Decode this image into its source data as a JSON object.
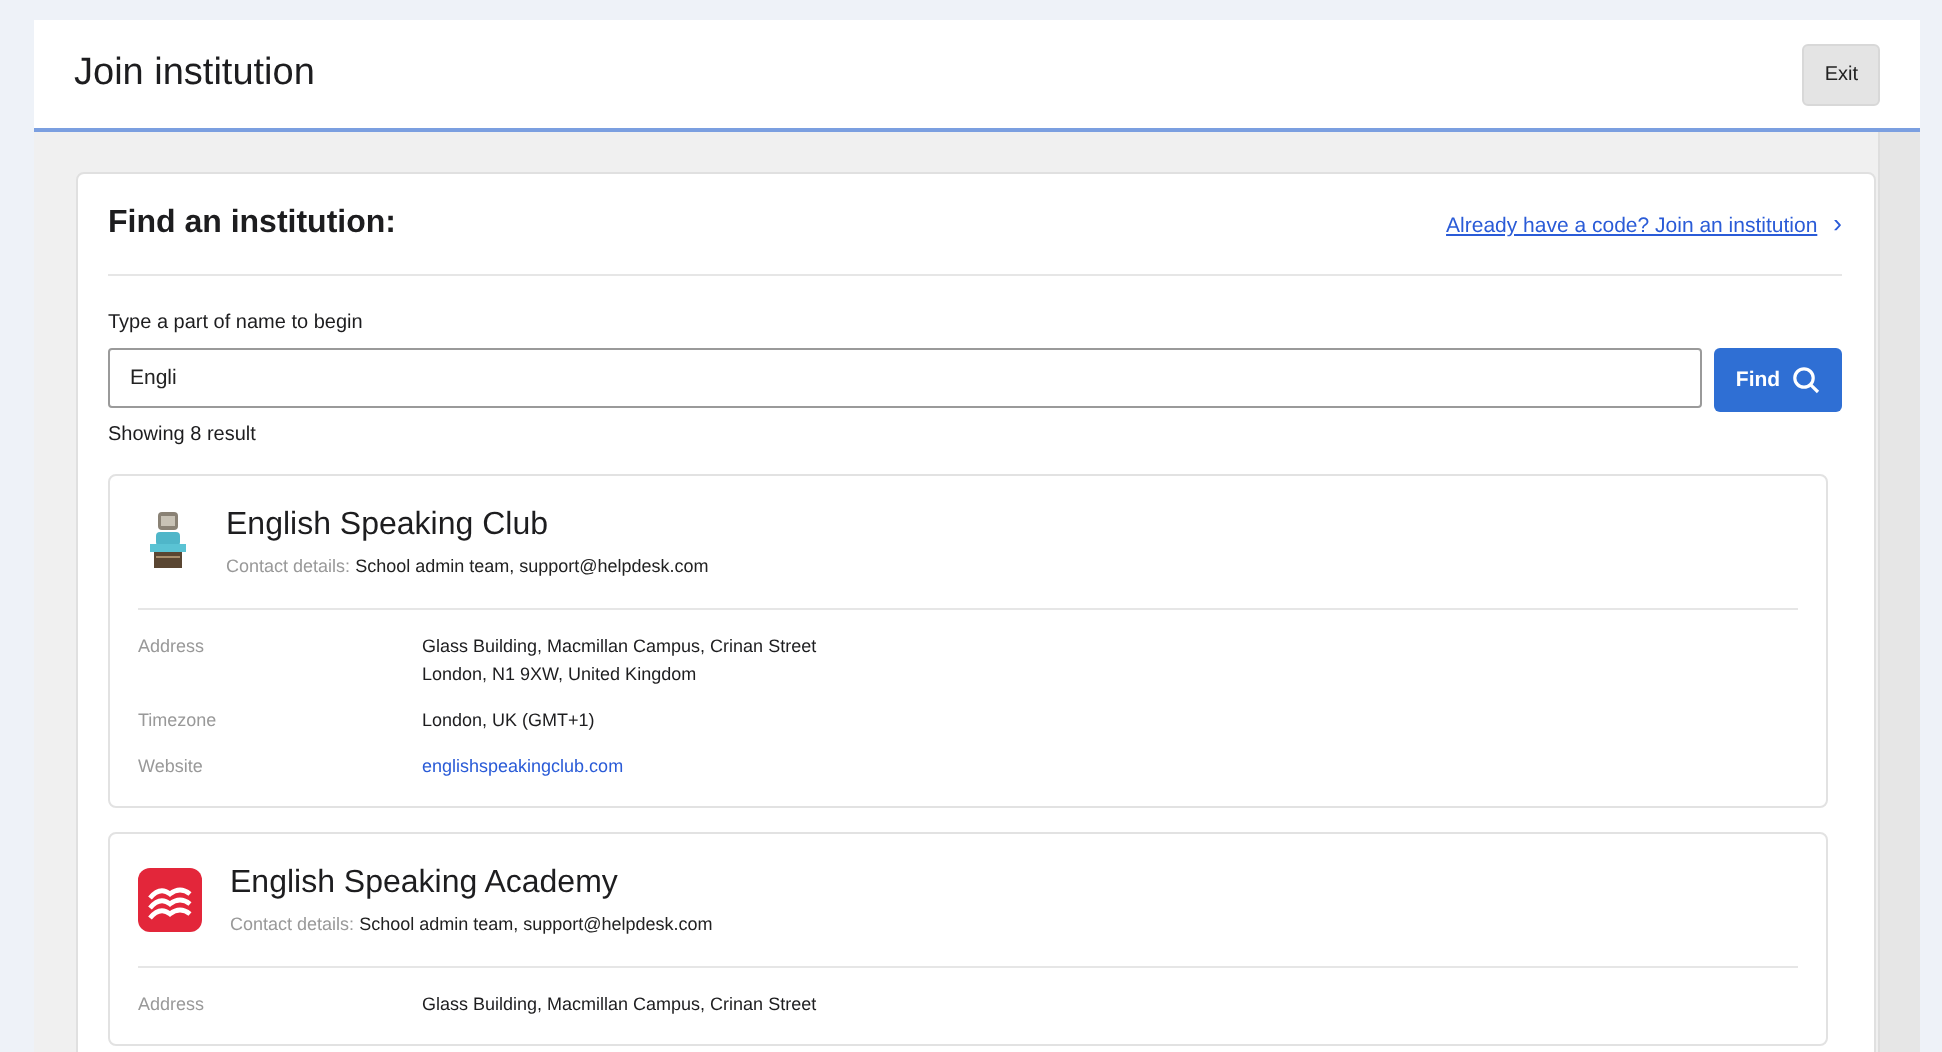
{
  "window": {
    "title": "Join institution",
    "exit_button": "Exit"
  },
  "finder": {
    "title": "Find an institution:",
    "code_link": "Already have a code? Join an institution",
    "code_link_chevron": "›",
    "search_label": "Type a part of name to begin",
    "search_value": "Engli",
    "find_button": "Find",
    "result_count": "Showing 8 result"
  },
  "results": [
    {
      "name": "English Speaking Club",
      "kind": "desk",
      "contact_label": "Contact details:",
      "contact": "School admin team, support@helpdesk.com",
      "details": [
        {
          "label": "Address",
          "kind": "text",
          "lines": [
            "Glass Building, Macmillan Campus, Crinan Street",
            "London, N1 9XW, United Kingdom"
          ]
        },
        {
          "label": "Timezone",
          "kind": "text",
          "lines": [
            "London, UK (GMT+1)"
          ]
        },
        {
          "label": "Website",
          "kind": "link",
          "lines": [
            "englishspeakingclub.com"
          ]
        }
      ]
    },
    {
      "name": "English Speaking Academy",
      "kind": "book",
      "contact_label": "Contact details:",
      "contact": "School admin team, support@helpdesk.com",
      "details": [
        {
          "label": "Address",
          "kind": "text",
          "lines": [
            "Glass Building, Macmillan Campus, Crinan Street"
          ]
        }
      ]
    }
  ]
}
